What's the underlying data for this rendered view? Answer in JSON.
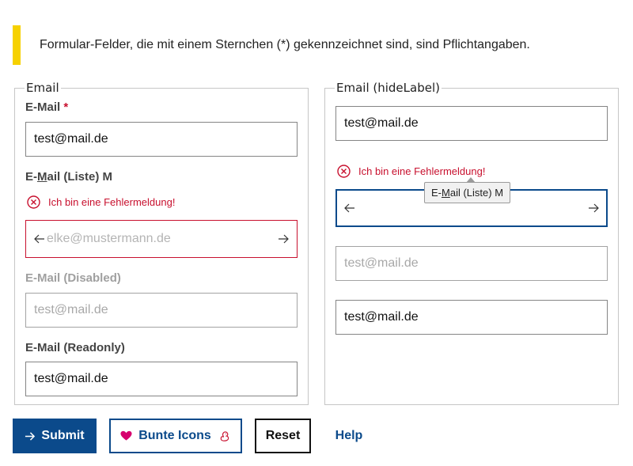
{
  "notice": {
    "text": "Formular-Felder, die mit einem Sternchen (*) gekennzeichnet sind, sind Pflichtangaben."
  },
  "left": {
    "legend": "Email",
    "email": {
      "label": "E-Mail",
      "required": "*",
      "value": "test@mail.de"
    },
    "list": {
      "label_pre": "E-",
      "label_underline": "M",
      "label_post": "ail (Liste)",
      "label_shortcut": "M",
      "error": "Ich bin eine Fehlermeldung!",
      "placeholder": "elke@mustermann.de"
    },
    "disabled": {
      "label": "E-Mail (Disabled)",
      "placeholder": "test@mail.de"
    },
    "readonly": {
      "label": "E-Mail (Readonly)",
      "value": "test@mail.de"
    }
  },
  "right": {
    "legend": "Email (hideLabel)",
    "email": {
      "value": "test@mail.de"
    },
    "error": "Ich bin eine Fehlermeldung!",
    "tooltip": {
      "pre": "E-",
      "underline": "M",
      "post": "ail (Liste)",
      "shortcut": "M"
    },
    "disabled": {
      "placeholder": "test@mail.de"
    },
    "readonly": {
      "value": "test@mail.de"
    }
  },
  "actions": {
    "submit": "Submit",
    "icons": "Bunte Icons",
    "reset": "Reset",
    "help": "Help"
  },
  "colors": {
    "primary": "#0b4a8b",
    "error": "#c8102e",
    "notice_bar": "#f6d100",
    "heart": "#d6006f"
  }
}
